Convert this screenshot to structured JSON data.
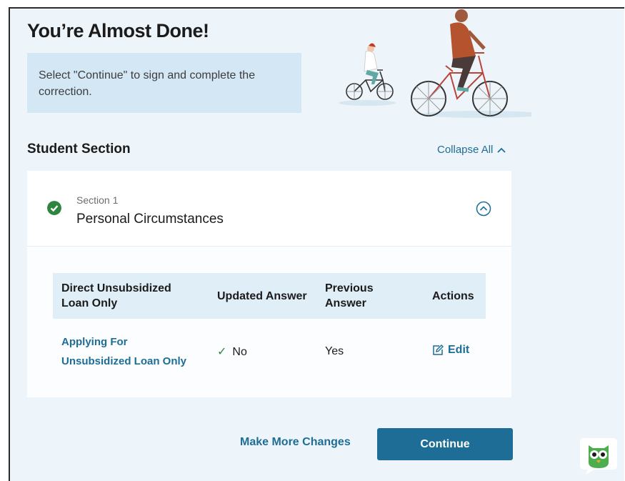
{
  "header": {
    "title": "You’re Almost Done!",
    "info_text": "Select \"Continue\" to sign and complete the correction."
  },
  "student_section": {
    "heading": "Student Section",
    "collapse_all_label": "Collapse All"
  },
  "section_card": {
    "section_label": "Section 1",
    "section_title": "Personal Circumstances",
    "status": "complete"
  },
  "table": {
    "headers": [
      "Direct Unsubsidized Loan Only",
      "Updated Answer",
      "Previous Answer",
      "Actions"
    ],
    "rows": [
      {
        "question": "Applying For Unsubsidized Loan Only",
        "updated_answer": "No",
        "previous_answer": "Yes",
        "action_label": "Edit"
      }
    ]
  },
  "footer": {
    "make_more_changes_label": "Make More Changes",
    "continue_label": "Continue"
  },
  "icons": {
    "status": "check-circle-icon",
    "toggle": "chevron-up-circle-icon",
    "collapse": "chevron-up-icon",
    "edit": "edit-icon",
    "chat": "owl-chat-icon"
  },
  "colors": {
    "accent": "#1e6d96",
    "success": "#2e8540",
    "page_background": "#eef5fa",
    "info_box": "#d3e7f4",
    "table_header": "#dfeef7"
  }
}
